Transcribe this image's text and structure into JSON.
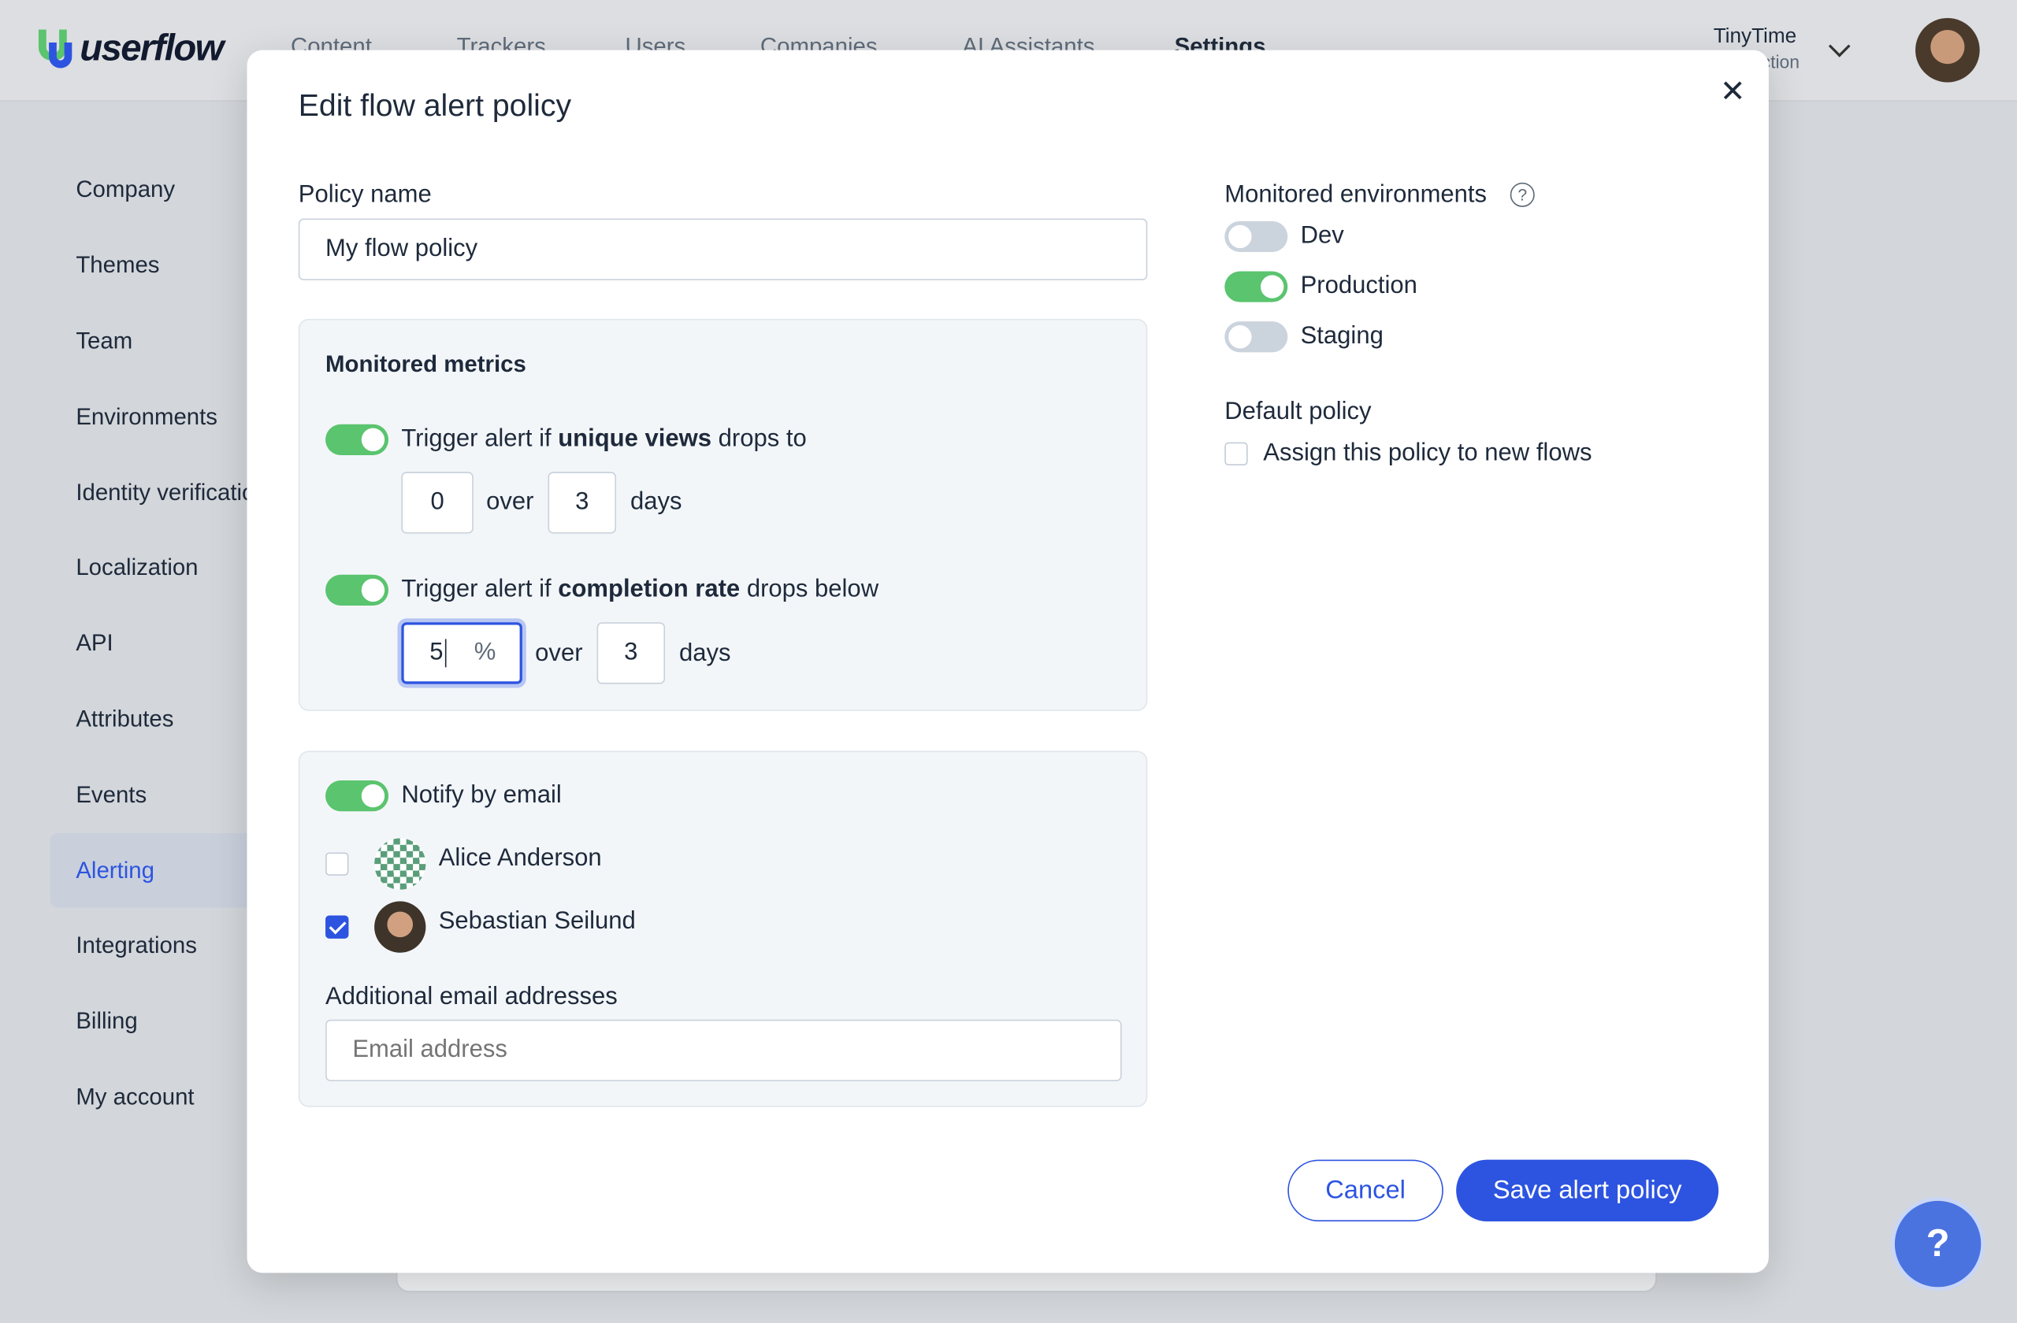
{
  "app": {
    "logo": "userflow"
  },
  "nav": {
    "tabs": [
      "Content",
      "Trackers",
      "Users",
      "Companies",
      "AI Assistants",
      "Settings"
    ],
    "active": "Settings"
  },
  "workspace": {
    "name": "TinyTime",
    "environment": "Production"
  },
  "sidebar": {
    "items": [
      "Company",
      "Themes",
      "Team",
      "Environments",
      "Identity verification",
      "Localization",
      "API",
      "Attributes",
      "Events",
      "Alerting",
      "Integrations",
      "Billing",
      "My account"
    ],
    "active": "Alerting"
  },
  "modal": {
    "title": "Edit flow alert policy",
    "policy_name_label": "Policy name",
    "policy_name_value": "My flow policy",
    "metrics": {
      "heading": "Monitored metrics",
      "views": {
        "enabled": true,
        "prefix": "Trigger alert if ",
        "bold": "unique views",
        "suffix": " drops to",
        "value": "0",
        "over": "over",
        "days_value": "3",
        "days": "days"
      },
      "completion": {
        "enabled": true,
        "prefix": "Trigger alert if ",
        "bold": "completion rate",
        "suffix": " drops below",
        "value": "5",
        "unit": "%",
        "over": "over",
        "days_value": "3",
        "days": "days"
      }
    },
    "notify": {
      "enabled": true,
      "label": "Notify by email",
      "users": [
        {
          "name": "Alice Anderson",
          "checked": false
        },
        {
          "name": "Sebastian Seilund",
          "checked": true
        }
      ],
      "additional_label": "Additional email addresses",
      "email_placeholder": "Email address"
    },
    "environments": {
      "label": "Monitored environments",
      "items": [
        {
          "name": "Dev",
          "enabled": false
        },
        {
          "name": "Production",
          "enabled": true
        },
        {
          "name": "Staging",
          "enabled": false
        }
      ]
    },
    "default_policy": {
      "label": "Default policy",
      "checkbox_label": "Assign this policy to new flows",
      "checked": false
    },
    "cancel_label": "Cancel",
    "save_label": "Save alert policy"
  },
  "colors": {
    "primary": "#2d54e0",
    "toggle_on": "#5ac46e",
    "toggle_off": "#cbd3dd"
  }
}
